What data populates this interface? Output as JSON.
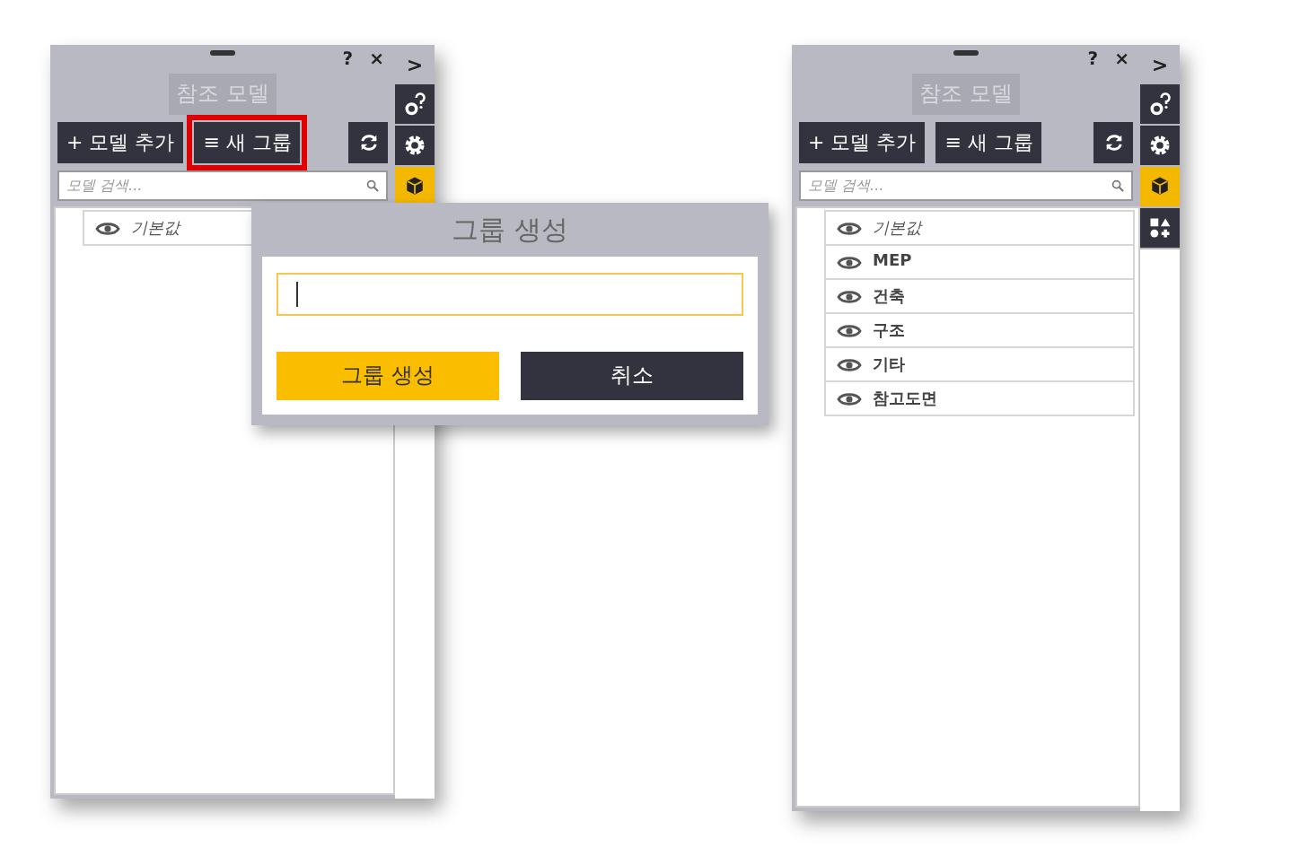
{
  "panels": [
    {
      "title": "참조 모델",
      "add_button": "+ 모델 추가",
      "group_button": {
        "label": "≡ 새 그룹",
        "highlighted": true
      },
      "search": {
        "placeholder": "모델 검색..."
      },
      "help": "?",
      "close": "×",
      "collapse": ">",
      "side_tabs": [
        {
          "kind": "gear-help",
          "selected": false
        },
        {
          "kind": "gear",
          "selected": false
        },
        {
          "kind": "cube",
          "selected": true
        }
      ],
      "items": [
        {
          "label": "기본값",
          "kind": "default"
        }
      ]
    },
    {
      "title": "참조 모델",
      "add_button": "+ 모델 추가",
      "group_button": {
        "label": "≡ 새 그룹",
        "highlighted": false
      },
      "search": {
        "placeholder": "모델 검색..."
      },
      "help": "?",
      "close": "×",
      "collapse": ">",
      "side_tabs": [
        {
          "kind": "gear-help",
          "selected": false
        },
        {
          "kind": "gear",
          "selected": false
        },
        {
          "kind": "cube",
          "selected": true
        },
        {
          "kind": "shapes",
          "selected": false
        }
      ],
      "items": [
        {
          "label": "기본값",
          "kind": "default"
        },
        {
          "label": "MEP",
          "kind": "group"
        },
        {
          "label": "건축",
          "kind": "group"
        },
        {
          "label": "구조",
          "kind": "group"
        },
        {
          "label": "기타",
          "kind": "group"
        },
        {
          "label": "참고도면",
          "kind": "group"
        }
      ]
    }
  ],
  "dialog": {
    "title": "그룹 생성",
    "input": {
      "focused": true
    },
    "confirm_button": "그룹 생성",
    "cancel_button": "취소"
  }
}
